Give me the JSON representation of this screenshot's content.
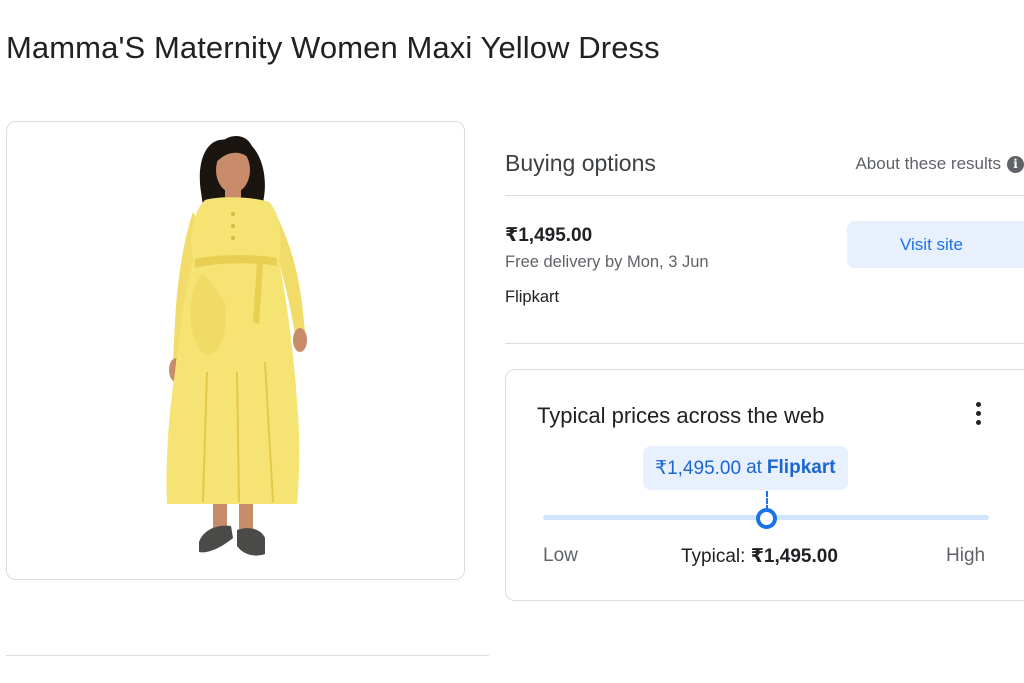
{
  "product": {
    "title": "Mamma'S Maternity Women Maxi Yellow Dress",
    "image_alt": "Woman wearing yellow maternity maxi dress"
  },
  "buying_options": {
    "title": "Buying options",
    "about_label": "About these results",
    "info_icon": "info-icon"
  },
  "offer": {
    "price": "₹1,495.00",
    "delivery": "Free delivery by Mon, 3 Jun",
    "seller": "Flipkart",
    "visit_label": "Visit site"
  },
  "price_insights": {
    "title": "Typical prices across the web",
    "current_price": "₹1,495.00",
    "at_label": "at",
    "current_seller": "Flipkart",
    "low_label": "Low",
    "high_label": "High",
    "typical_label": "Typical:",
    "typical_value": "₹1,495.00",
    "menu_icon": "more-vert-icon"
  },
  "colors": {
    "accent": "#1a73e8",
    "accent_bg": "#e8f0fe",
    "dress": "#f5e374"
  }
}
